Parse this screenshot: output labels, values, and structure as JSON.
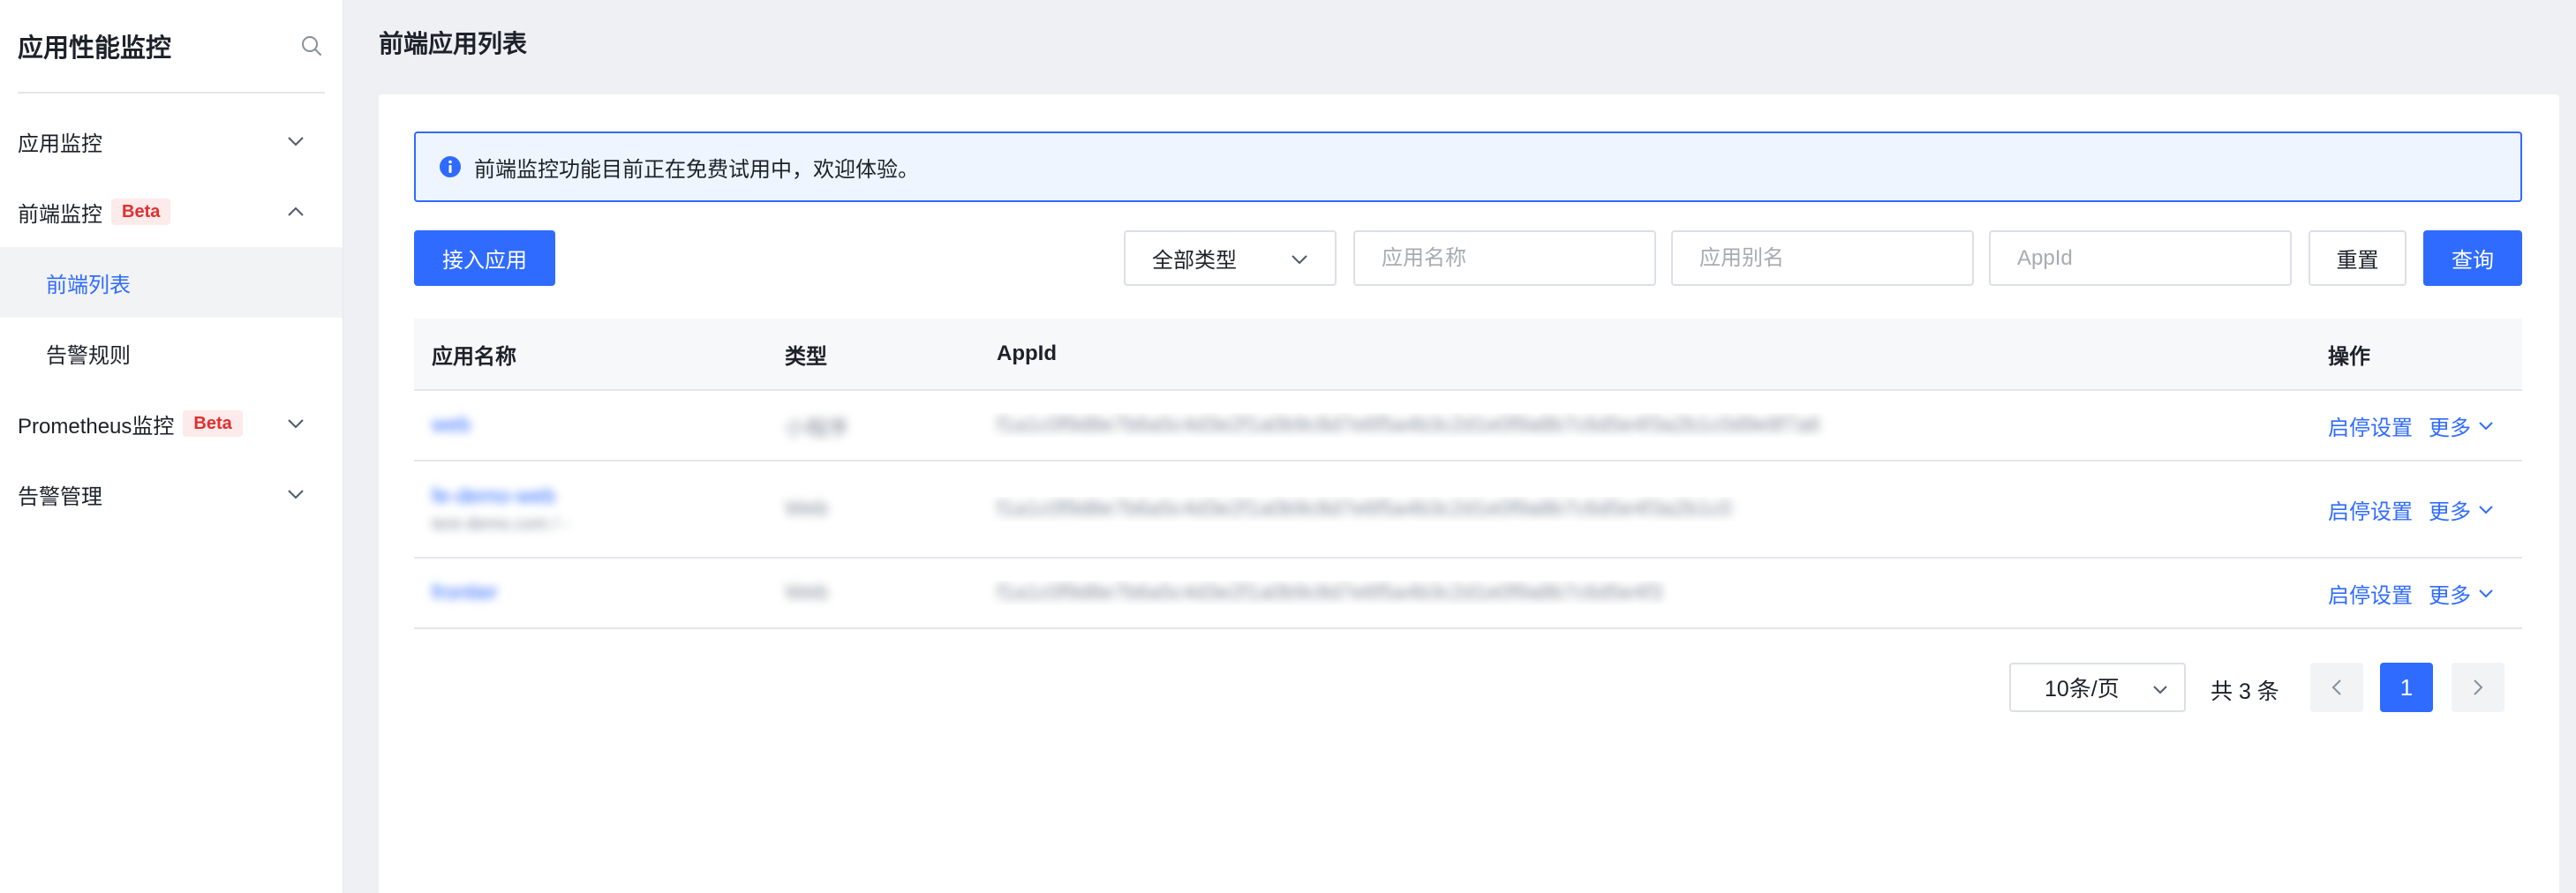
{
  "sidebar": {
    "title": "应用性能监控",
    "items": [
      {
        "label": "应用监控"
      },
      {
        "label": "前端监控",
        "badge": "Beta"
      },
      {
        "label": "前端列表"
      },
      {
        "label": "告警规则"
      },
      {
        "label": "Prometheus监控",
        "badge": "Beta"
      },
      {
        "label": "告警管理"
      }
    ]
  },
  "page": {
    "title": "前端应用列表"
  },
  "alert": {
    "text": "前端监控功能目前正在免费试用中，欢迎体验。"
  },
  "toolbar": {
    "add_app_label": "接入应用",
    "type_select_value": "全部类型",
    "name_placeholder": "应用名称",
    "alias_placeholder": "应用别名",
    "appid_placeholder": "AppId",
    "reset_label": "重置",
    "query_label": "查询"
  },
  "table": {
    "headers": [
      "应用名称",
      "类型",
      "AppId",
      "操作"
    ],
    "rows": [
      {
        "name": "web",
        "sub": "",
        "type": "小程序",
        "appid": "f1a1c0f9d8e7b6a5c4d3e2f1a0b9c8d7e6f5a4b3c2d1e0f9a8b7c6d5e4f3a2b1c0d9e8f7a6",
        "op": "启停设置",
        "more": "更多"
      },
      {
        "name": "fe-demo-web",
        "sub": "test-demo.com / -",
        "type": "Web",
        "appid": "f1a1c0f9d8e7b6a5c4d3e2f1a0b9c8d7e6f5a4b3c2d1e0f9a8b7c6d5e4f3a2b1c0",
        "op": "启停设置",
        "more": "更多"
      },
      {
        "name": "frontier",
        "sub": "",
        "type": "Web",
        "appid": "f1a1c0f9d8e7b6a5c4d3e2f1a0b9c8d7e6f5a4b3c2d1e0f9a8b7c6d5e4f3",
        "op": "启停设置",
        "more": "更多"
      }
    ]
  },
  "pagination": {
    "page_size": "10条/页",
    "total_text": "共 3 条",
    "current": "1"
  },
  "colors": {
    "primary": "#2f6bff",
    "danger": "#e02f2f",
    "background": "#eef0f4"
  }
}
